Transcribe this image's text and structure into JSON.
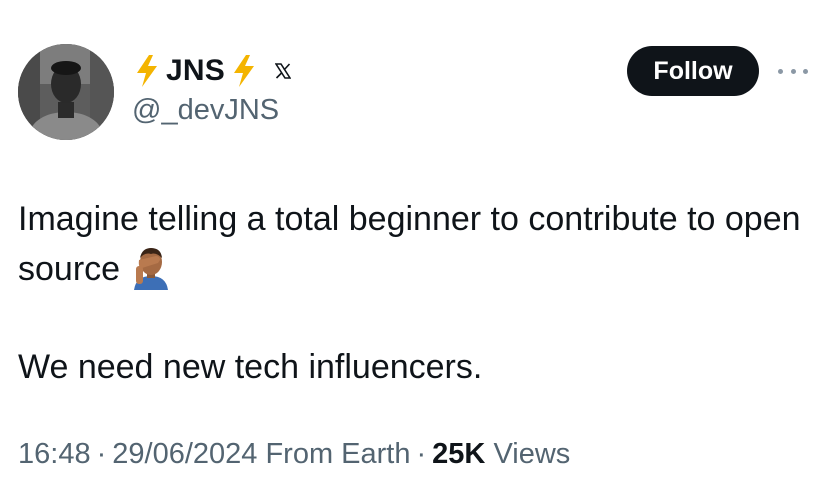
{
  "author": {
    "display_name": "JNS",
    "handle": "@_devJNS",
    "badge_icon": "x-logo-icon",
    "name_decoration_icon": "lightning-bolt-icon",
    "name_decoration_color": "#f4b400"
  },
  "actions": {
    "follow_label": "Follow",
    "more_icon": "more-horizontal-icon"
  },
  "tweet": {
    "line_1": "Imagine telling a total beginner to contribute to open source",
    "line_1_emoji": "face-palm-emoji",
    "line_2": "We need new tech influencers."
  },
  "meta": {
    "time": "16:48",
    "date": "29/06/2024",
    "source": "From Earth",
    "separator": "·",
    "views_count": "25K",
    "views_label": "Views"
  },
  "colors": {
    "text_primary": "#0f1419",
    "text_secondary": "#536471",
    "follow_bg": "#0f1419",
    "follow_text": "#ffffff"
  }
}
